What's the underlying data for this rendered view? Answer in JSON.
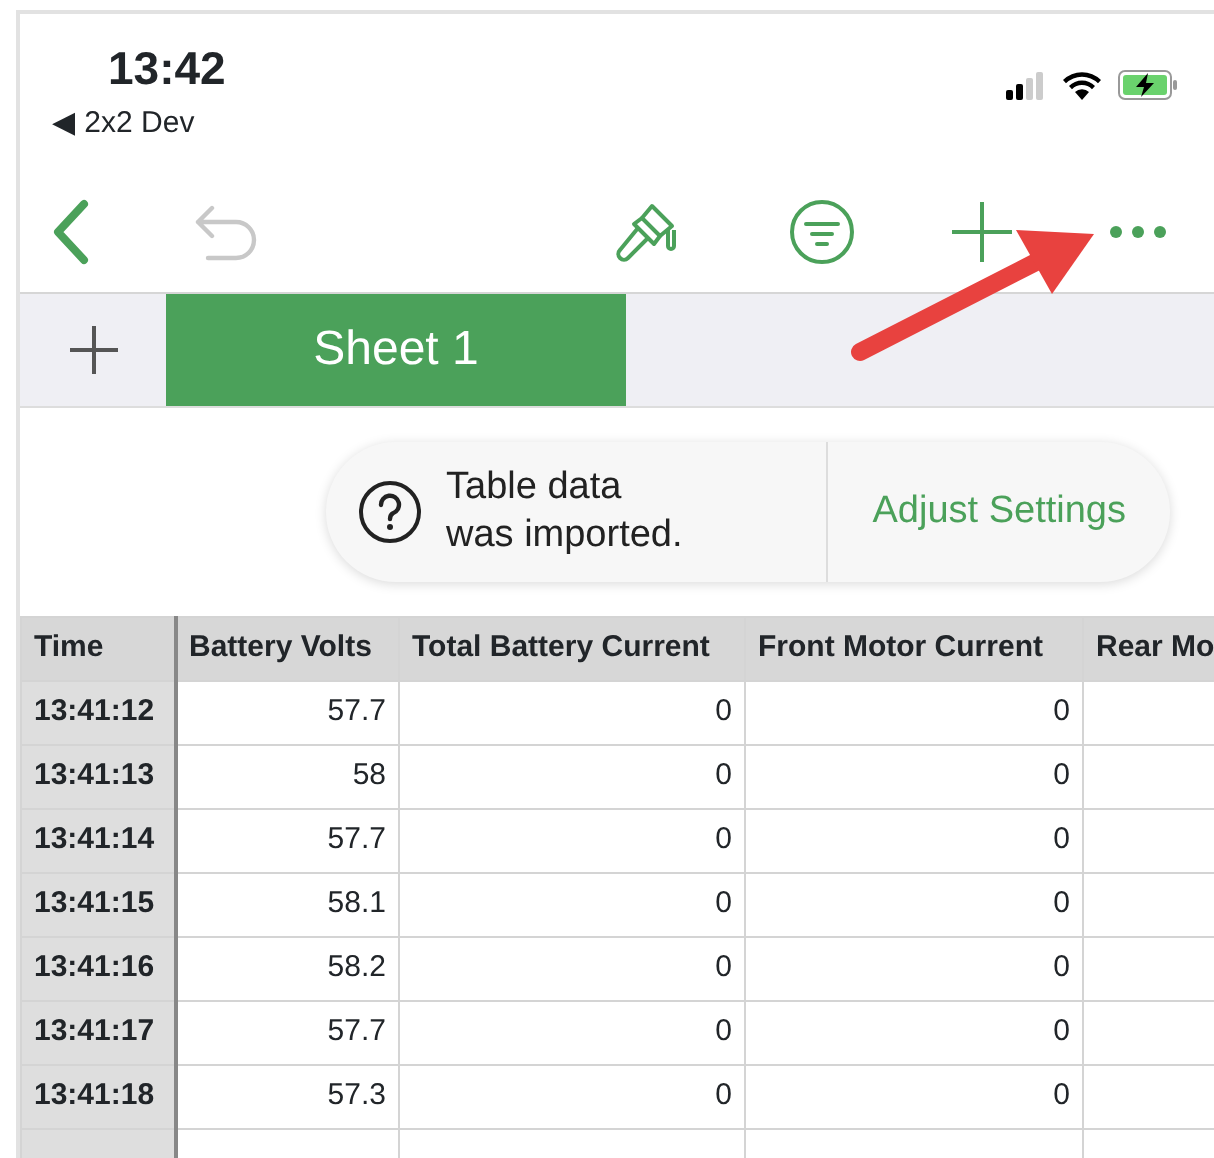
{
  "status_bar": {
    "time": "13:42",
    "back_app": "◀ 2x2 Dev"
  },
  "toolbar": {
    "undo_disabled": true
  },
  "sheet_tabs": [
    {
      "label": "Sheet 1",
      "selected": true
    }
  ],
  "toast": {
    "message": "Table data\nwas imported.",
    "action": "Adjust Settings"
  },
  "table": {
    "columns": [
      "Time",
      "Battery Volts",
      "Total Battery Current",
      "Front Motor Current",
      "Rear Mo"
    ],
    "rows": [
      {
        "cells": [
          "13:41:12",
          "57.7",
          "0",
          "0",
          ""
        ]
      },
      {
        "cells": [
          "13:41:13",
          "58",
          "0",
          "0",
          ""
        ]
      },
      {
        "cells": [
          "13:41:14",
          "57.7",
          "0",
          "0",
          ""
        ]
      },
      {
        "cells": [
          "13:41:15",
          "58.1",
          "0",
          "0",
          ""
        ]
      },
      {
        "cells": [
          "13:41:16",
          "58.2",
          "0",
          "0",
          ""
        ]
      },
      {
        "cells": [
          "13:41:17",
          "57.7",
          "0",
          "0",
          ""
        ]
      },
      {
        "cells": [
          "13:41:18",
          "57.3",
          "0",
          "0",
          ""
        ]
      }
    ]
  }
}
